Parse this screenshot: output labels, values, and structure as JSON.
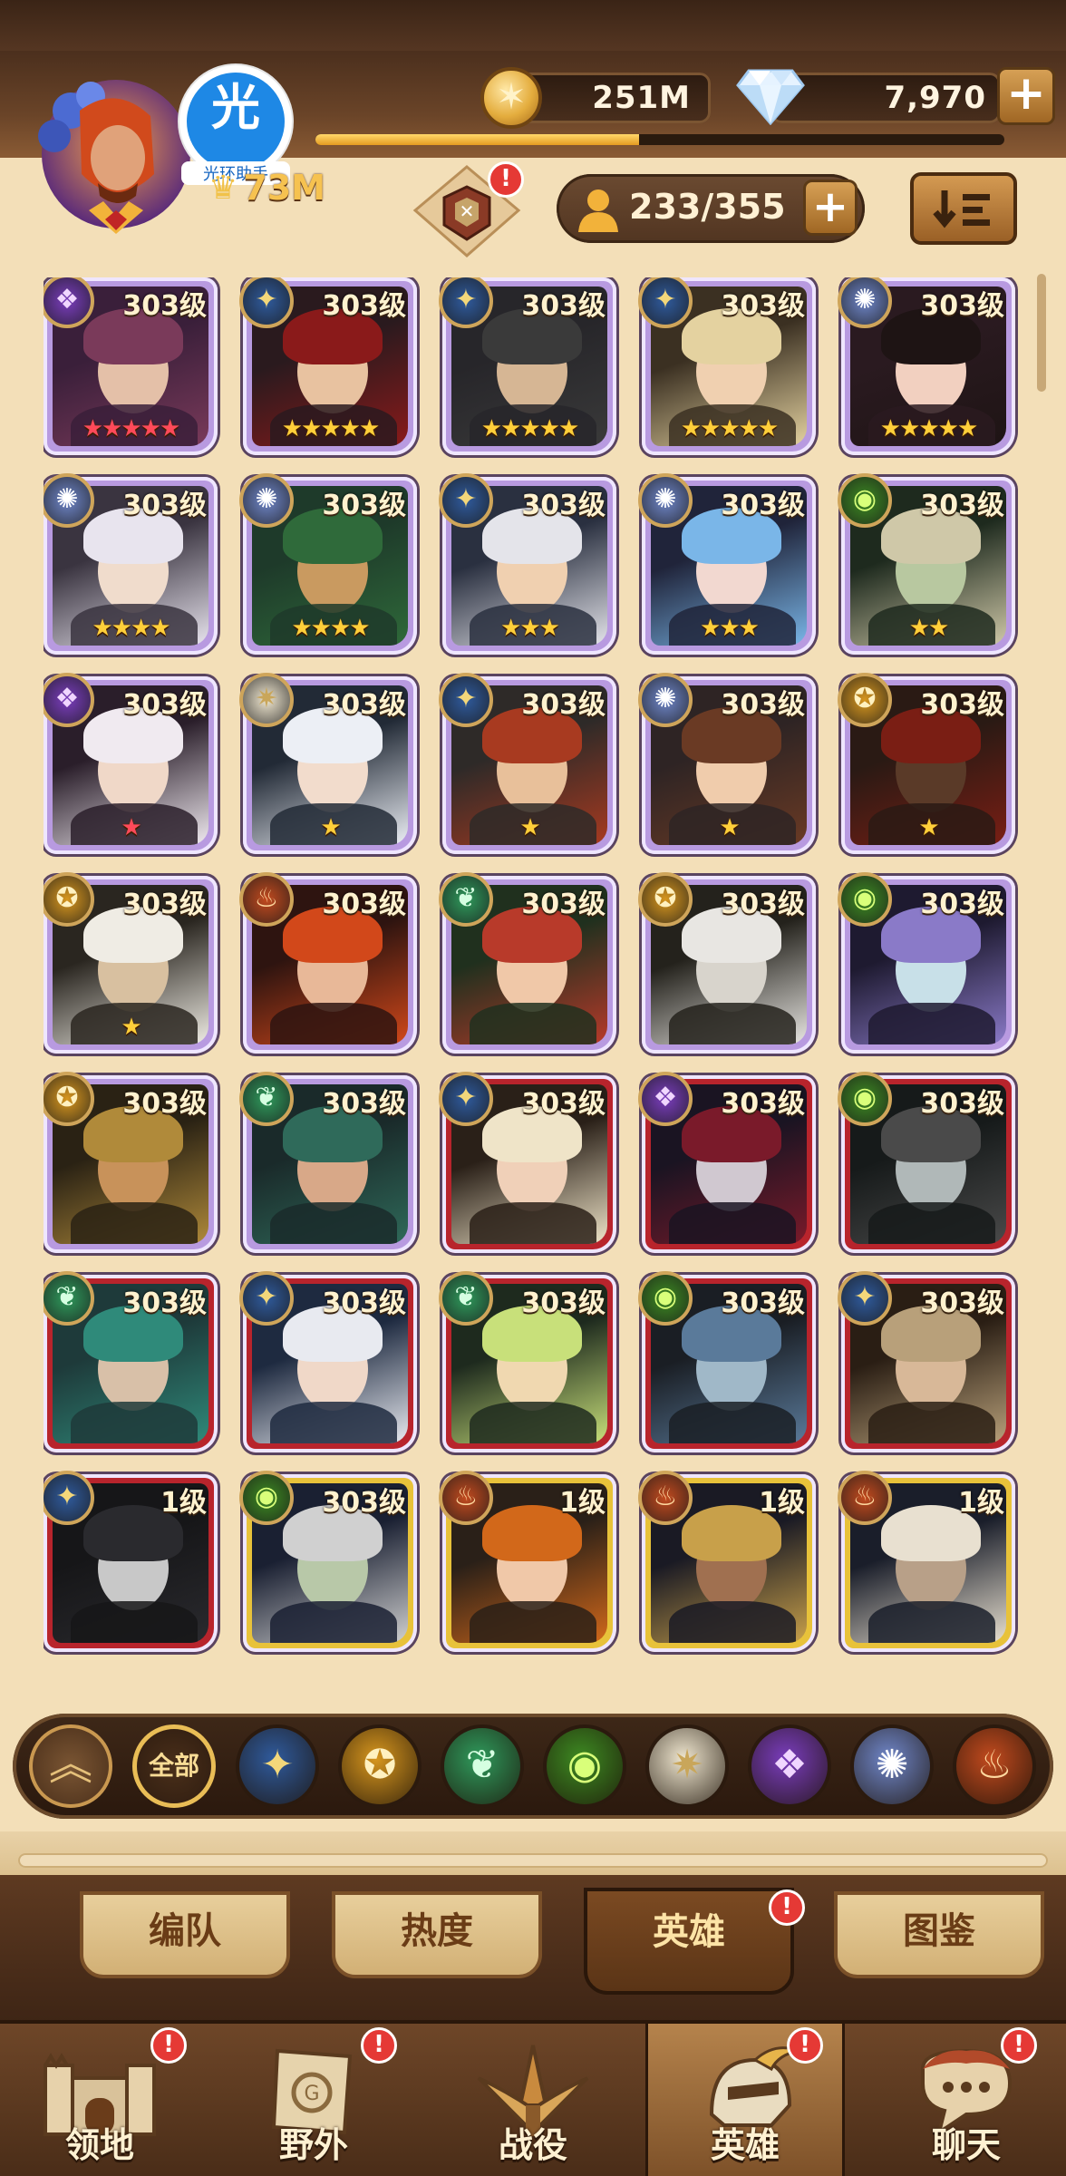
{
  "header": {
    "gold_value": "251M",
    "diamond_value": "7,970",
    "power_value": "73M",
    "hero_capacity": "233/355",
    "xp_progress": 0.47,
    "helper_char": "光",
    "helper_label": "光环助手",
    "notification_mark": "!"
  },
  "filters": {
    "all_label": "全部",
    "factions": [
      "lightbearer-icon",
      "mauler-icon",
      "wilder-icon",
      "graveborn-icon",
      "celestial-icon",
      "hypogean-icon",
      "dimensional-icon",
      "dragon-icon"
    ]
  },
  "tabs": [
    {
      "label": "编队",
      "badge": false
    },
    {
      "label": "热度",
      "badge": false
    },
    {
      "label": "英雄",
      "badge": true
    },
    {
      "label": "图鉴",
      "badge": false
    }
  ],
  "nav": [
    {
      "label": "领地",
      "badge": true
    },
    {
      "label": "野外",
      "badge": true
    },
    {
      "label": "战役",
      "badge": false
    },
    {
      "label": "英雄",
      "badge": true
    },
    {
      "label": "聊天",
      "badge": true
    }
  ],
  "heroes": [
    {
      "level": "303级",
      "faction": "hypogean",
      "rank": "ascended",
      "stars": 5,
      "star_color": "red"
    },
    {
      "level": "303级",
      "faction": "lightbearer",
      "rank": "ascended",
      "stars": 5,
      "star_color": "gold"
    },
    {
      "level": "303级",
      "faction": "lightbearer",
      "rank": "ascended",
      "stars": 5,
      "star_color": "gold"
    },
    {
      "level": "303级",
      "faction": "lightbearer",
      "rank": "ascended",
      "stars": 5,
      "star_color": "gold"
    },
    {
      "level": "303级",
      "faction": "dimensional",
      "rank": "ascended",
      "stars": 5,
      "star_color": "gold"
    },
    {
      "level": "303级",
      "faction": "dimensional",
      "rank": "ascended",
      "stars": 4,
      "star_color": "gold"
    },
    {
      "level": "303级",
      "faction": "dimensional",
      "rank": "ascended",
      "stars": 4,
      "star_color": "gold"
    },
    {
      "level": "303级",
      "faction": "lightbearer",
      "rank": "ascended",
      "stars": 3,
      "star_color": "gold"
    },
    {
      "level": "303级",
      "faction": "dimensional",
      "rank": "ascended",
      "stars": 3,
      "star_color": "gold"
    },
    {
      "level": "303级",
      "faction": "graveborn",
      "rank": "ascended",
      "stars": 2,
      "star_color": "gold"
    },
    {
      "level": "303级",
      "faction": "hypogean",
      "rank": "ascended",
      "stars": 1,
      "star_color": "red"
    },
    {
      "level": "303级",
      "faction": "celestial",
      "rank": "ascended",
      "stars": 1,
      "star_color": "gold"
    },
    {
      "level": "303级",
      "faction": "lightbearer",
      "rank": "ascended",
      "stars": 1,
      "star_color": "gold"
    },
    {
      "level": "303级",
      "faction": "dimensional",
      "rank": "ascended",
      "stars": 1,
      "star_color": "gold"
    },
    {
      "level": "303级",
      "faction": "mauler",
      "rank": "ascended",
      "stars": 1,
      "star_color": "gold"
    },
    {
      "level": "303级",
      "faction": "mauler",
      "rank": "ascended",
      "stars": 1,
      "star_color": "gold"
    },
    {
      "level": "303级",
      "faction": "dragon",
      "rank": "ascended",
      "stars": 0,
      "star_color": "gold"
    },
    {
      "level": "303级",
      "faction": "wilder",
      "rank": "ascended",
      "stars": 0,
      "star_color": "gold"
    },
    {
      "level": "303级",
      "faction": "mauler",
      "rank": "ascended",
      "stars": 0,
      "star_color": "gold"
    },
    {
      "level": "303级",
      "faction": "graveborn",
      "rank": "ascended",
      "stars": 0,
      "star_color": "gold"
    },
    {
      "level": "303级",
      "faction": "mauler",
      "rank": "ascended",
      "stars": 0,
      "star_color": "gold"
    },
    {
      "level": "303级",
      "faction": "wilder",
      "rank": "ascended",
      "stars": 0,
      "star_color": "gold"
    },
    {
      "level": "303级",
      "faction": "lightbearer",
      "rank": "mythic",
      "stars": 0,
      "star_color": "gold"
    },
    {
      "level": "303级",
      "faction": "hypogean",
      "rank": "mythic",
      "stars": 0,
      "star_color": "gold"
    },
    {
      "level": "303级",
      "faction": "graveborn",
      "rank": "mythic",
      "stars": 0,
      "star_color": "gold"
    },
    {
      "level": "303级",
      "faction": "wilder",
      "rank": "mythic",
      "stars": 0,
      "star_color": "gold"
    },
    {
      "level": "303级",
      "faction": "lightbearer",
      "rank": "mythic",
      "stars": 0,
      "star_color": "gold"
    },
    {
      "level": "303级",
      "faction": "wilder",
      "rank": "mythic",
      "stars": 0,
      "star_color": "gold"
    },
    {
      "level": "303级",
      "faction": "graveborn",
      "rank": "mythic",
      "stars": 0,
      "star_color": "gold"
    },
    {
      "level": "303级",
      "faction": "lightbearer",
      "rank": "mythic",
      "stars": 0,
      "star_color": "gold"
    },
    {
      "level": "1级",
      "faction": "lightbearer",
      "rank": "mythic",
      "stars": 0,
      "star_color": "gold"
    },
    {
      "level": "303级",
      "faction": "graveborn",
      "rank": "legendary",
      "stars": 0,
      "star_color": "gold"
    },
    {
      "level": "1级",
      "faction": "dragon",
      "rank": "legendary",
      "stars": 0,
      "star_color": "gold"
    },
    {
      "level": "1级",
      "faction": "dragon",
      "rank": "legendary",
      "stars": 0,
      "star_color": "gold"
    },
    {
      "level": "1级",
      "faction": "dragon",
      "rank": "legendary",
      "stars": 0,
      "star_color": "gold"
    }
  ],
  "colors": {
    "ascended_frame": "#b89ae0",
    "mythic_frame": "#b8242c",
    "legendary_frame": "#e8c23a",
    "lightbearer": "#2f5a9c",
    "mauler": "#d7961e",
    "wilder": "#2f9a5c",
    "graveborn": "#3d8a22",
    "celestial": "#efe6cf",
    "hypogean": "#7a3dbd",
    "dimensional": "#6f86c9",
    "dragon": "#c24a1e"
  }
}
